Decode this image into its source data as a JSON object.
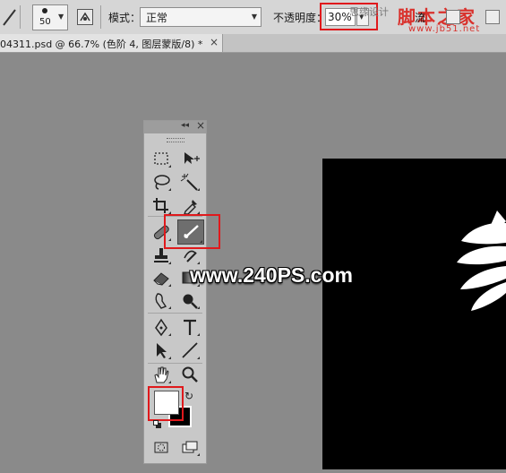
{
  "options_bar": {
    "brush_size": "50",
    "mode_label": "模式：",
    "mode_value": "正常",
    "opacity_label": "不透明度：",
    "opacity_value": "30%",
    "flow_label": "流",
    "watermark_site": "思缘设计",
    "watermark_logo": "脚本之家",
    "watermark_url": "www.jb51.net"
  },
  "document_tab": {
    "title": "04311.psd @ 66.7% (色阶 4, 图层蒙版/8) *",
    "close_glyph": "×"
  },
  "tool_panel": {
    "collapse_glyph": "◂◂",
    "close_glyph": "×",
    "selected_tool": "brush-tool",
    "foreground_color": "#ffffff",
    "background_color": "#000000"
  },
  "watermark": {
    "text": "www.240PS.com"
  },
  "colors": {
    "highlight_red": "#e0191c",
    "canvas_gray": "#8a8a8a",
    "document_bg": "#000000"
  }
}
